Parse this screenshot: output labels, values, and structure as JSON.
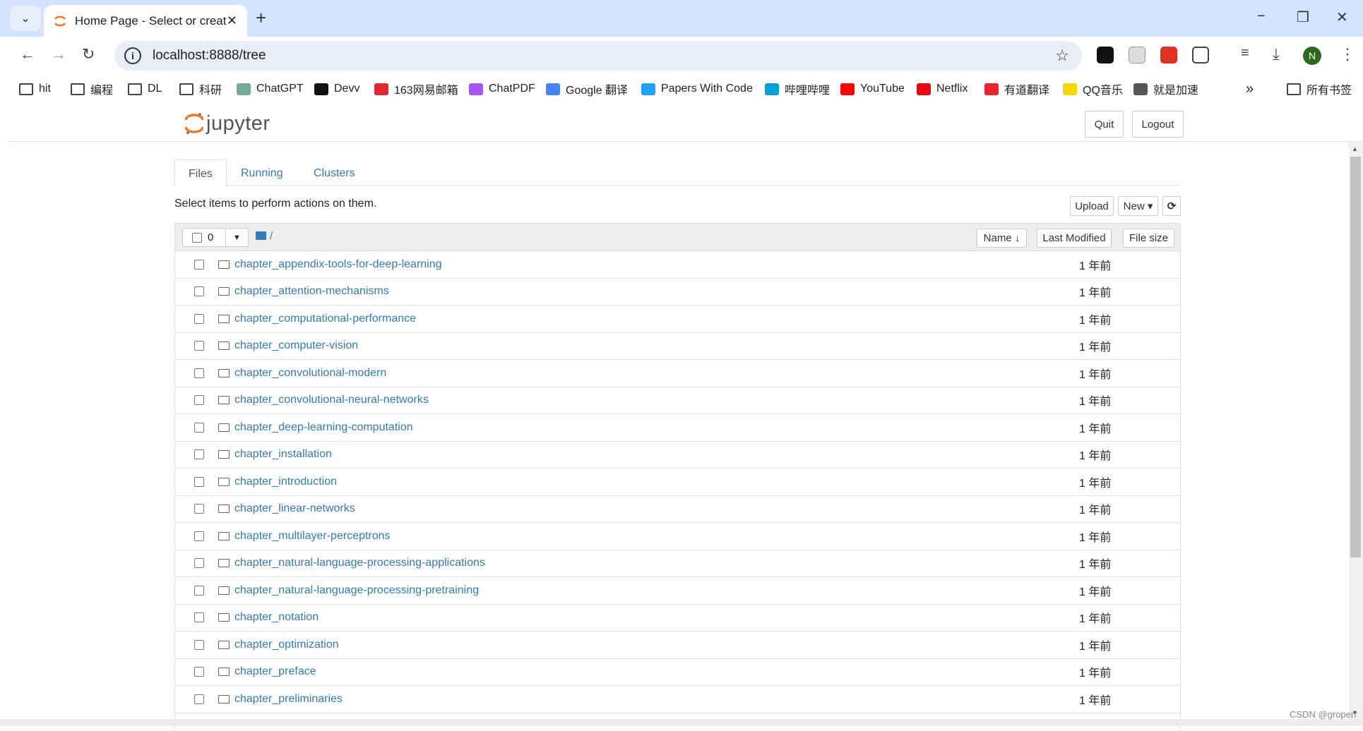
{
  "browser": {
    "tab_title": "Home Page - Select or create",
    "url": "localhost:8888/tree",
    "profile_initial": "N",
    "bookmarks": [
      {
        "label": "hit",
        "icon": "folder-icon"
      },
      {
        "label": "编程",
        "icon": "folder-icon"
      },
      {
        "label": "DL",
        "icon": "folder-icon"
      },
      {
        "label": "科研",
        "icon": "folder-icon"
      },
      {
        "label": "ChatGPT",
        "icon": "chatgpt-icon",
        "color": "#74aa9c"
      },
      {
        "label": "Devv",
        "icon": "devv-icon",
        "color": "#111111"
      },
      {
        "label": "163网易邮箱",
        "icon": "mail163-icon",
        "color": "#e0292f"
      },
      {
        "label": "ChatPDF",
        "icon": "chatpdf-icon",
        "color": "#a855f7"
      },
      {
        "label": "Google 翻译",
        "icon": "google-translate-icon",
        "color": "#4285f4"
      },
      {
        "label": "Papers With Code",
        "icon": "paperswithcode-icon",
        "color": "#21a0f4"
      },
      {
        "label": "哔哩哔哩",
        "icon": "bilibili-icon",
        "color": "#00a1d6"
      },
      {
        "label": "YouTube",
        "icon": "youtube-icon",
        "color": "#ff0000"
      },
      {
        "label": "Netflix",
        "icon": "netflix-icon",
        "color": "#e50914"
      },
      {
        "label": "有道翻译",
        "icon": "youdao-icon",
        "color": "#e9242c"
      },
      {
        "label": "QQ音乐",
        "icon": "qqmusic-icon",
        "color": "#f7d700"
      },
      {
        "label": "就是加速",
        "icon": "globe-icon",
        "color": "#555555"
      }
    ],
    "all_bookmarks": "所有书签",
    "overflow": "»"
  },
  "header": {
    "logo_text": "jupyter",
    "quit": "Quit",
    "logout": "Logout"
  },
  "tabs": [
    {
      "label": "Files",
      "active": true
    },
    {
      "label": "Running"
    },
    {
      "label": "Clusters"
    }
  ],
  "hint": "Select items to perform actions on them.",
  "actions": {
    "upload": "Upload",
    "new": "New ▾",
    "refresh": "⟳"
  },
  "list_header": {
    "selected_count": "0",
    "path": "/",
    "sort_name": "Name ↓",
    "last_modified": "Last Modified",
    "file_size": "File size"
  },
  "files": [
    {
      "name": "chapter_appendix-tools-for-deep-learning",
      "modified": "1 年前"
    },
    {
      "name": "chapter_attention-mechanisms",
      "modified": "1 年前"
    },
    {
      "name": "chapter_computational-performance",
      "modified": "1 年前"
    },
    {
      "name": "chapter_computer-vision",
      "modified": "1 年前"
    },
    {
      "name": "chapter_convolutional-modern",
      "modified": "1 年前"
    },
    {
      "name": "chapter_convolutional-neural-networks",
      "modified": "1 年前"
    },
    {
      "name": "chapter_deep-learning-computation",
      "modified": "1 年前"
    },
    {
      "name": "chapter_installation",
      "modified": "1 年前"
    },
    {
      "name": "chapter_introduction",
      "modified": "1 年前"
    },
    {
      "name": "chapter_linear-networks",
      "modified": "1 年前"
    },
    {
      "name": "chapter_multilayer-perceptrons",
      "modified": "1 年前"
    },
    {
      "name": "chapter_natural-language-processing-applications",
      "modified": "1 年前"
    },
    {
      "name": "chapter_natural-language-processing-pretraining",
      "modified": "1 年前"
    },
    {
      "name": "chapter_notation",
      "modified": "1 年前"
    },
    {
      "name": "chapter_optimization",
      "modified": "1 年前"
    },
    {
      "name": "chapter_preface",
      "modified": "1 年前"
    },
    {
      "name": "chapter_preliminaries",
      "modified": "1 年前"
    }
  ],
  "watermark": "CSDN @groperr",
  "colors": {
    "link": "#337ab7",
    "jupyter_orange": "#f37726",
    "tabbar": "#d3e3fd"
  }
}
